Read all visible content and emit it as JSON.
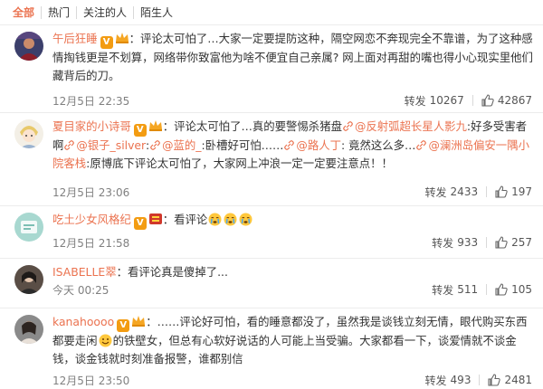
{
  "tabs": [
    "全部",
    "热门",
    "关注的人",
    "陌生人"
  ],
  "comments": [
    {
      "user": "午后狂睡",
      "sep": "：",
      "text": "评论太可怕了…大家一定要提防这种，隔空网恋不奔现完全不靠谱，为了这种感情掏钱更是不划算，网络带你致富他为啥不便宜自己亲属? 网上面对再甜的嘴也得小心现实里他们藏背后的刀。",
      "time": "12月5日 22:35",
      "repost_label": "转发",
      "reposts": "10267",
      "likes": "42867"
    },
    {
      "user": "夏目家的小诗哥",
      "sep": "：",
      "text_a": "评论太可怕了…真的要警惕杀猪盘",
      "mention_1": "@反射弧超长星人影九",
      "text_b": ":好多受害者啊",
      "mention_2": "@银子_silver",
      "mention_3": "@蓝的_",
      "text_c": ":卧槽好可怕……",
      "mention_4": "@路人丁",
      "text_d": ": 竟然这么多…",
      "mention_5": "@澜洲岛偏安一隅小院客栈",
      "text_e": ":原博底下评论太可怕了，大家网上冲浪一定一定要注意点！！",
      "time": "12月5日 23:06",
      "repost_label": "转发",
      "reposts": "2433",
      "likes": "197"
    },
    {
      "user": "吃土少女风格纪",
      "sep": "：",
      "text": "看评论",
      "time": "12月5日 21:58",
      "repost_label": "转发",
      "reposts": "933",
      "likes": "257"
    },
    {
      "user": "ISABELLE翠",
      "sep": "：",
      "text": "看评论真是傻掉了...",
      "time": "今天 00:25",
      "repost_label": "转发",
      "reposts": "511",
      "likes": "105"
    },
    {
      "user": "kanahoooo",
      "sep": "：",
      "text": "……评论好可怕，看的睡意都没了，虽然我是谈钱立刻无情，眼代购买东西都要走闲",
      "text_2": "的铁壁女，但总有心软好说话的人可能上当受骗。大家都看一下，谈爱情就不谈金钱，谈金钱就时刻准备报警，谁都别信",
      "time": "12月5日 23:50",
      "repost_label": "转发",
      "reposts": "493",
      "likes": "2481"
    }
  ],
  "colors": {
    "accent": "#eb7350",
    "muted": "#808080",
    "border": "#ececec"
  }
}
